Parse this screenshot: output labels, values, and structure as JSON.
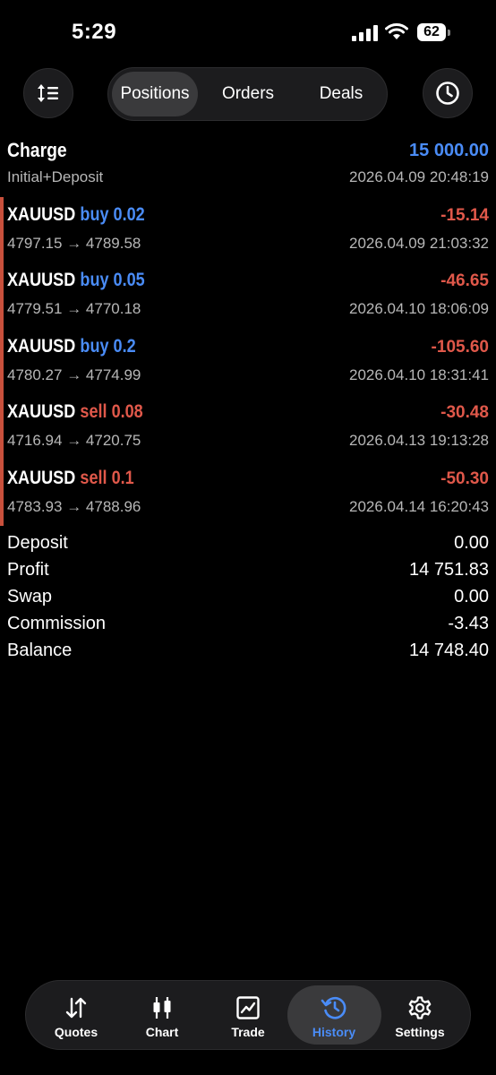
{
  "status_bar": {
    "time": "5:29",
    "battery": "62"
  },
  "segments": [
    "Positions",
    "Orders",
    "Deals"
  ],
  "active_segment": "Positions",
  "charge": {
    "title": "Charge",
    "amount": "15 000.00",
    "subtitle": "Initial+Deposit",
    "datetime": "2026.04.09 20:48:19"
  },
  "trades": [
    {
      "symbol": "XAUUSD",
      "side": "buy 0.02",
      "profit": "-15.14",
      "open": "4797.15",
      "close": "4789.58",
      "datetime": "2026.04.09 21:03:32"
    },
    {
      "symbol": "XAUUSD",
      "side": "buy 0.05",
      "profit": "-46.65",
      "open": "4779.51",
      "close": "4770.18",
      "datetime": "2026.04.10 18:06:09"
    },
    {
      "symbol": "XAUUSD",
      "side": "buy 0.2",
      "profit": "-105.60",
      "open": "4780.27",
      "close": "4774.99",
      "datetime": "2026.04.10 18:31:41"
    },
    {
      "symbol": "XAUUSD",
      "side": "sell 0.08",
      "profit": "-30.48",
      "open": "4716.94",
      "close": "4720.75",
      "datetime": "2026.04.13 19:13:28"
    },
    {
      "symbol": "XAUUSD",
      "side": "sell 0.1",
      "profit": "-50.30",
      "open": "4783.93",
      "close": "4788.96",
      "datetime": "2026.04.14 16:20:43"
    }
  ],
  "arrow": "→",
  "summary": [
    {
      "label": "Deposit",
      "value": "0.00"
    },
    {
      "label": "Profit",
      "value": "14 751.83"
    },
    {
      "label": "Swap",
      "value": "0.00"
    },
    {
      "label": "Commission",
      "value": "-3.43"
    },
    {
      "label": "Balance",
      "value": "14 748.40"
    }
  ],
  "tabs": [
    {
      "label": "Quotes",
      "icon": "quotes-arrows-icon"
    },
    {
      "label": "Chart",
      "icon": "candlestick-icon"
    },
    {
      "label": "Trade",
      "icon": "trade-chart-icon"
    },
    {
      "label": "History",
      "icon": "history-clock-icon"
    },
    {
      "label": "Settings",
      "icon": "gear-icon"
    }
  ],
  "active_tab": "History",
  "colors": {
    "accent": "#4a8cf7",
    "negative": "#e0584a",
    "background": "#000000"
  }
}
